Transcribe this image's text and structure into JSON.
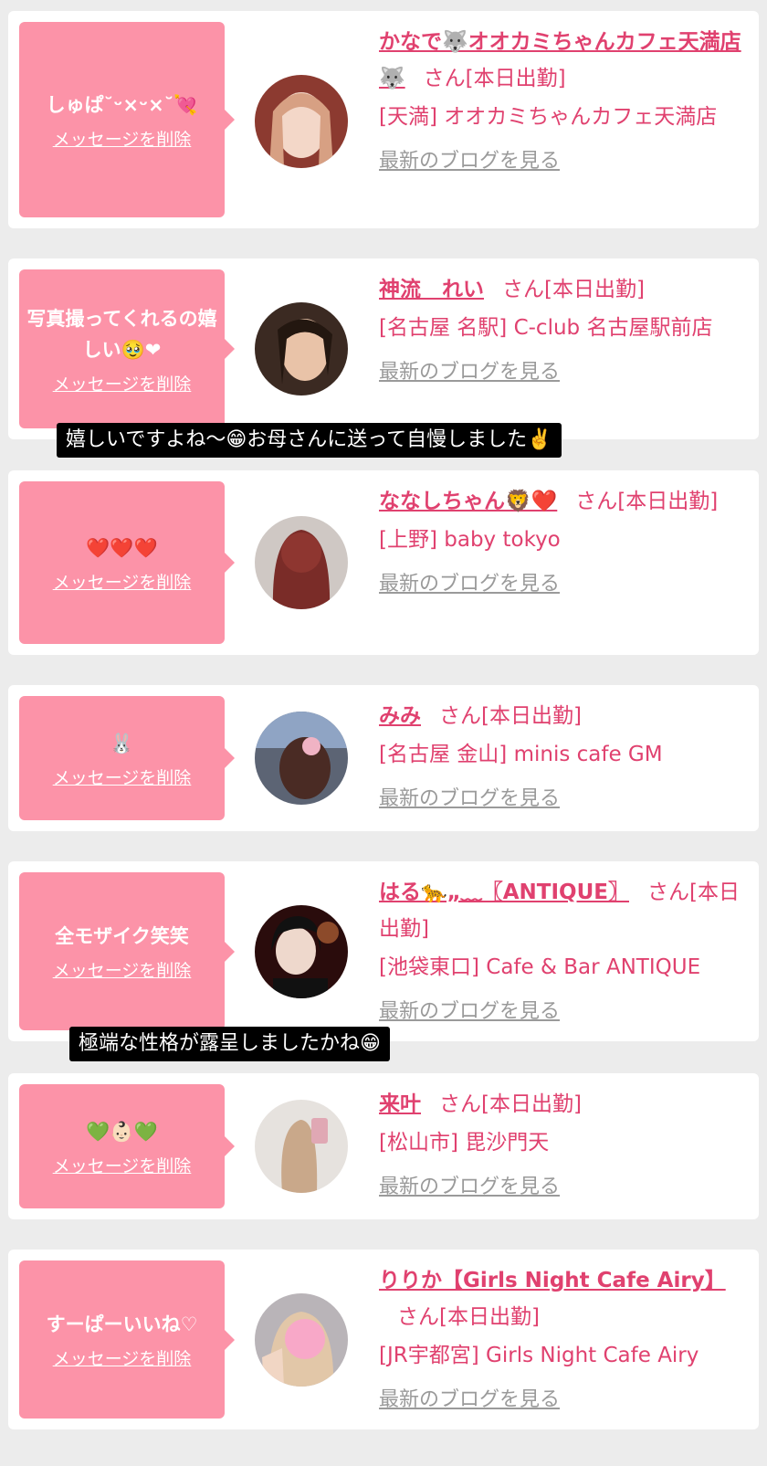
{
  "delete_label": "メッセージを削除",
  "blog_label": "最新のブログを見る",
  "san_suffix": "さん[本日出勤]",
  "cards": [
    {
      "message": "しゅぱ˘ᵕ×ᵕ×˘💘",
      "name": "かなで🐺オオカミちゃんカフェ天満店🐺",
      "shop": "[天満] オオカミちゃんカフェ天満店",
      "avatar_color": "#b4685a"
    },
    {
      "message": "写真撮ってくれるの嬉しい🥹❤",
      "name": "神流　れい",
      "shop": "[名古屋 名駅] C-club 名古屋駅前店",
      "avatar_color": "#7d5a48"
    },
    {
      "message": "❤️❤️❤️",
      "name": "ななしちゃん🦁❤️",
      "shop": "[上野] baby tokyo",
      "avatar_color": "#6e2f2a"
    },
    {
      "message": "🐰",
      "name": "みみ",
      "shop": "[名古屋 金山] minis cafe GM",
      "avatar_color": "#6a6f7c"
    },
    {
      "message": "全モザイク笑笑",
      "name": "はる🐆„﹏〖ANTIQUE〗",
      "shop": "[池袋東口] Cafe & Bar ANTIQUE",
      "avatar_color": "#3d1616"
    },
    {
      "message": "💚👶🏻💚",
      "name": "来叶",
      "shop": "[松山市] 毘沙門天",
      "avatar_color": "#d6cfc8"
    },
    {
      "message": "すーぱーいいね♡",
      "name": "りりか【Girls Night Cafe Airy】",
      "shop": "[JR宇都宮] Girls Night Cafe Airy",
      "avatar_color": "#c7a699"
    }
  ],
  "captions": [
    "嬉しいですよね〜😁お母さんに送って自慢しました✌️",
    "極端な性格が露呈しましたかね😁"
  ]
}
